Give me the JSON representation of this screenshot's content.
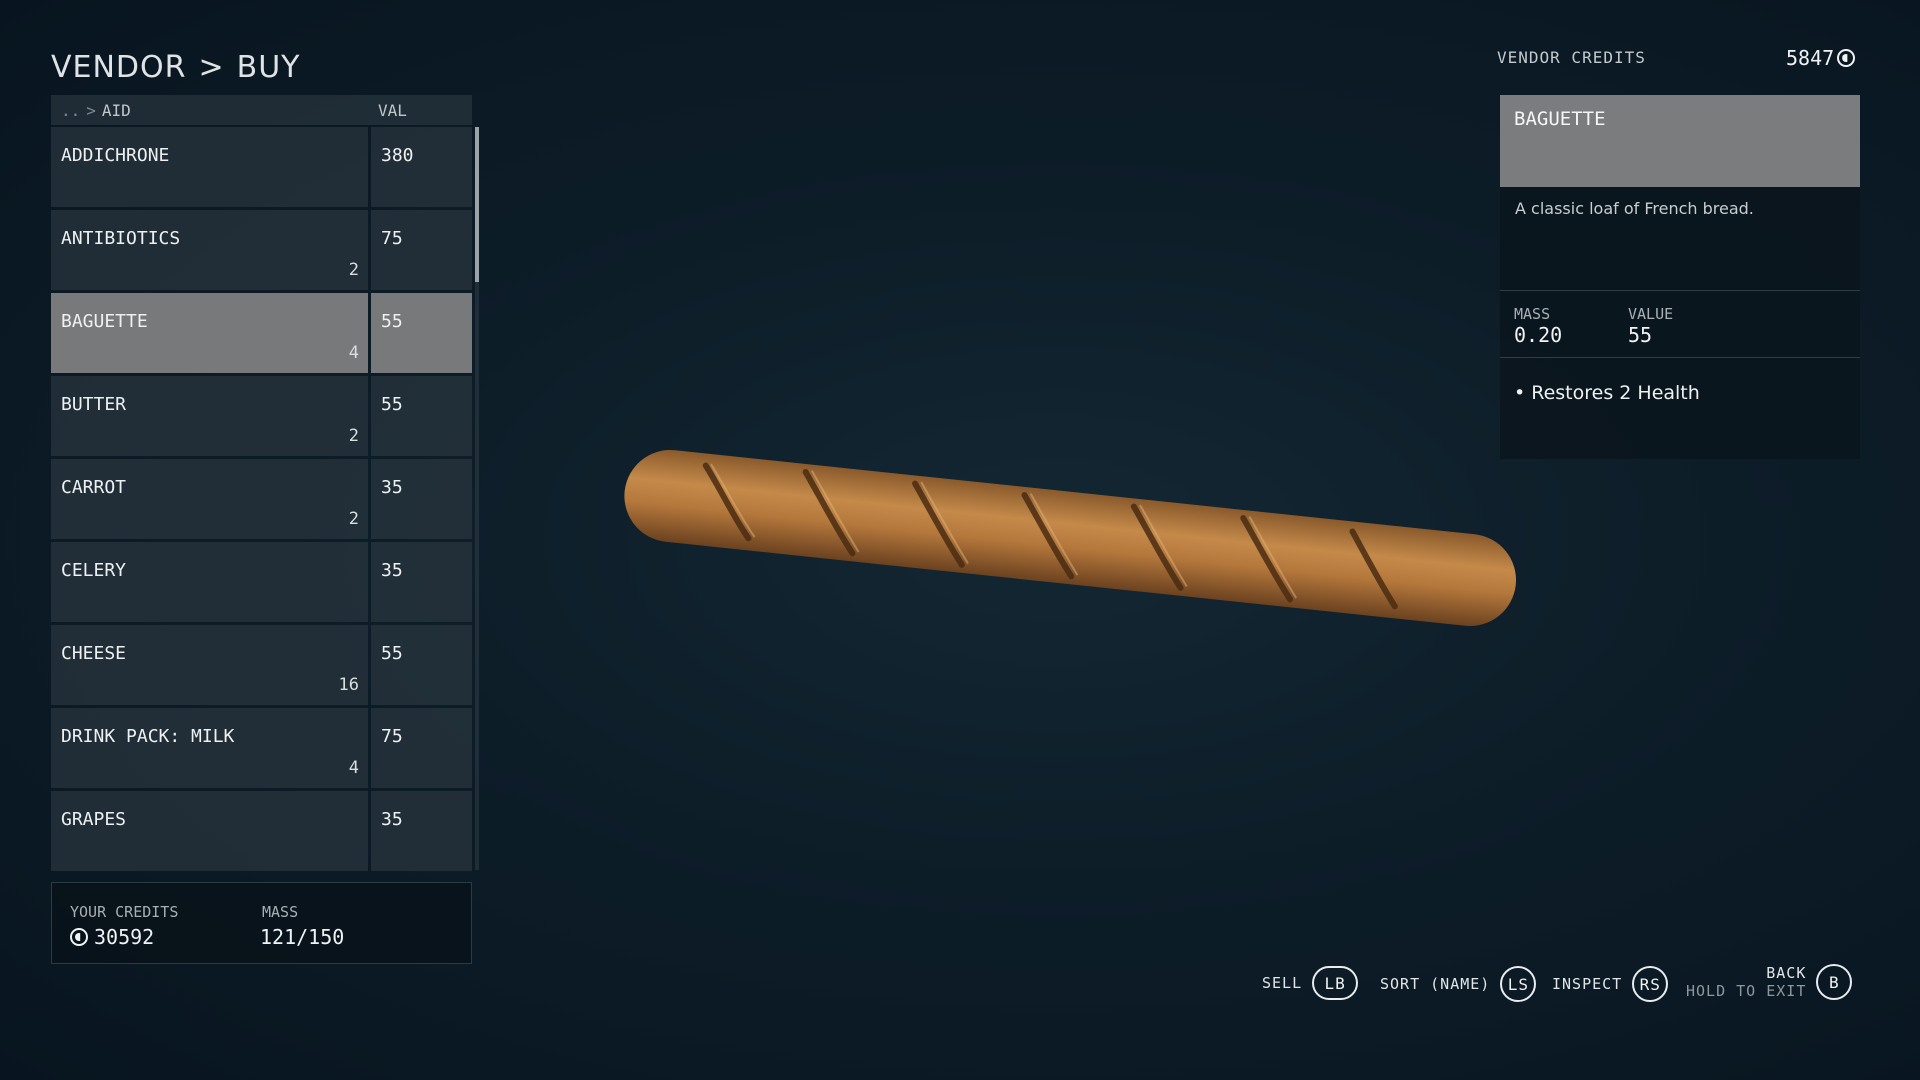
{
  "header": {
    "section": "VENDOR",
    "separator": ">",
    "mode": "BUY"
  },
  "list": {
    "breadcrumb_dots": "..",
    "breadcrumb_sep": ">",
    "category": "AID",
    "value_header": "VAL",
    "items": [
      {
        "name": "ADDICHRONE",
        "qty": "",
        "val": "380"
      },
      {
        "name": "ANTIBIOTICS",
        "qty": "2",
        "val": "75"
      },
      {
        "name": "BAGUETTE",
        "qty": "4",
        "val": "55",
        "selected": true
      },
      {
        "name": "BUTTER",
        "qty": "2",
        "val": "55"
      },
      {
        "name": "CARROT",
        "qty": "2",
        "val": "35"
      },
      {
        "name": "CELERY",
        "qty": "",
        "val": "35"
      },
      {
        "name": "CHEESE",
        "qty": "16",
        "val": "55"
      },
      {
        "name": "DRINK PACK: MILK",
        "qty": "4",
        "val": "75"
      },
      {
        "name": "GRAPES",
        "qty": "",
        "val": "35"
      }
    ]
  },
  "player": {
    "credits_label": "YOUR CREDITS",
    "credits": "30592",
    "mass_label": "MASS",
    "mass": "121/150"
  },
  "vendor": {
    "credits_label": "VENDOR CREDITS",
    "credits": "5847"
  },
  "detail": {
    "name": "BAGUETTE",
    "description": "A classic loaf of French bread.",
    "mass_label": "MASS",
    "mass": "0.20",
    "value_label": "VALUE",
    "value": "55",
    "effect": "• Restores 2 Health"
  },
  "controls": {
    "sell_label": "SELL",
    "sell_key": "LB",
    "sort_label": "SORT (NAME)",
    "sort_key": "LS",
    "inspect_label": "INSPECT",
    "inspect_key": "RS",
    "back_label": "BACK",
    "back_sub": "HOLD TO EXIT",
    "back_key": "B"
  },
  "colors": {
    "selected_row": "#77797b",
    "row_bg": "#2e3a42",
    "background": "#0d1d28"
  }
}
